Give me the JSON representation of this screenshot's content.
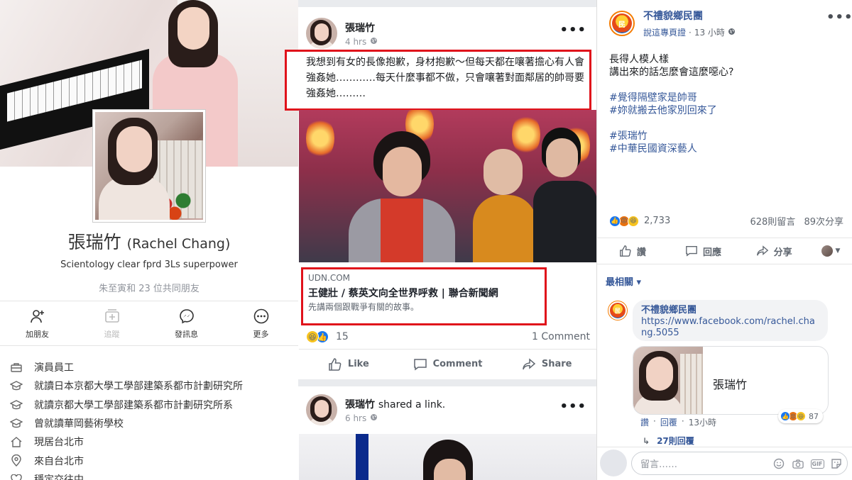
{
  "profile": {
    "name_zh": "張瑞竹",
    "name_en": "(Rachel Chang)",
    "bio": "Scientology clear fprd 3Ls superpower",
    "mutual_friends": "朱至寅和 23 位共同朋友",
    "actions": [
      {
        "label": "加朋友",
        "icon": "add-friend-icon"
      },
      {
        "label": "追蹤",
        "icon": "follow-icon"
      },
      {
        "label": "發訊息",
        "icon": "messenger-icon"
      },
      {
        "label": "更多",
        "icon": "more-icon"
      }
    ],
    "about": [
      {
        "text": "演員員工",
        "icon": "briefcase-icon"
      },
      {
        "text": "就讀日本京都大學工學部建築系都市計劃研究所",
        "icon": "graduation-cap-icon"
      },
      {
        "text": "就讀京都大學工學部建築系都市計劃研究所系",
        "icon": "graduation-cap-icon"
      },
      {
        "text": "曾就讀華岡藝術學校",
        "icon": "graduation-cap-icon"
      },
      {
        "text": "現居台北市",
        "icon": "home-icon"
      },
      {
        "text": "來自台北市",
        "icon": "location-pin-icon"
      },
      {
        "text": "穩定交往中",
        "icon": "heart-icon"
      }
    ]
  },
  "feed": {
    "post1": {
      "author": "張瑞竹",
      "time": "4 hrs",
      "more": "•••",
      "text": "我想到有女的長像抱歉，身材抱歉～但每天都在嚷著擔心有人會強姦她…………每天什麼事都不做，只會嚷著對面鄰居的帥哥要強姦她………",
      "link": {
        "domain": "UDN.COM",
        "title": "王健壯 / 蔡英文向全世界呼救 | 聯合新聞網",
        "description": "先講兩個跟戰爭有關的故事。"
      },
      "reaction_count": "15",
      "comment_count": "1 Comment",
      "actions": {
        "like": "Like",
        "comment": "Comment",
        "share": "Share"
      }
    },
    "post2": {
      "author": "張瑞竹",
      "shared_text": "shared a link.",
      "time": "6 hrs",
      "more": "•••"
    }
  },
  "page_post": {
    "page_name": "不禮貌鄉民團",
    "edit_link": "說這專頁證",
    "time": "13 小時",
    "lines": [
      "長得人模人樣",
      "講出來的話怎麼會這麼噁心?"
    ],
    "tags1": [
      "#覺得隔壁家是帥哥",
      "#妳就搬去他家別回來了"
    ],
    "tags2": [
      "#張瑞竹",
      "#中華民國資深藝人"
    ],
    "reaction_count": "2,733",
    "comments": "628則留言",
    "shares": "89次分享",
    "actions": {
      "like": "讚",
      "comment": "回應",
      "share": "分享"
    },
    "sort": "最相關 ▾",
    "comment": {
      "author": "不禮貌鄉民團",
      "url": "https://www.facebook.com/rachel.chang.5055",
      "card_name": "張瑞竹",
      "reactions": "87",
      "like": "讚",
      "reply": "回覆",
      "time": "13小時",
      "replies": "27則回覆"
    },
    "composer_placeholder": "留言……"
  },
  "colors": {
    "highlight_border": "#e0121b",
    "link_blue": "#365899",
    "feed_bg": "#e9ebee"
  }
}
